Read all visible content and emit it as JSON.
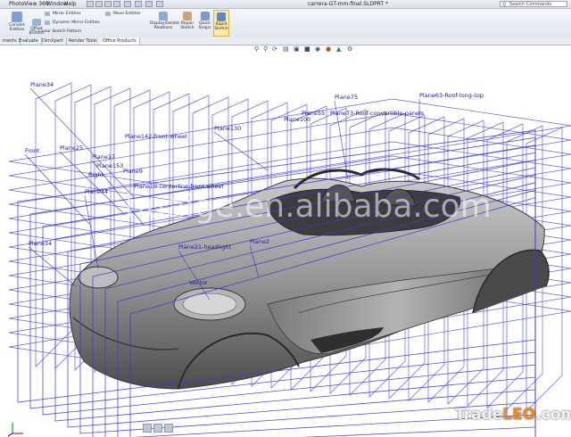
{
  "window": {
    "title": "carrera-GT-mm-final.SLDPRT *",
    "menus": [
      "PhotoView 360",
      "Window",
      "Help"
    ],
    "search_placeholder": "Search Commands"
  },
  "ribbon": {
    "buttons": [
      {
        "name": "convert-entities",
        "label1": "Convert",
        "label2": "Entities"
      },
      {
        "name": "offset-entities",
        "label1": "Offset",
        "label2": "Entities"
      },
      {
        "name": "display-delete-relations",
        "label1": "Display/Delete",
        "label2": "Relations"
      },
      {
        "name": "repair-sketch",
        "label1": "Repair",
        "label2": "Sketch"
      },
      {
        "name": "quick-snaps",
        "label1": "Quick",
        "label2": "Snaps"
      },
      {
        "name": "rapid-sketch",
        "label1": "Rapid",
        "label2": "Sketch"
      }
    ],
    "items": {
      "mirror": "Mirror Entities",
      "dynamic_mirror": "Dynamic Mirror Entities",
      "linear_pattern": "Linear Sketch Pattern",
      "move": "Move Entities"
    }
  },
  "tabs": [
    "ments",
    "Evaluate",
    "DimXpert",
    "Render Tools",
    "Office Products"
  ],
  "planes": {
    "p34a": "Plane34",
    "front": "Front",
    "p25": "Plane25",
    "p17": "Plane17",
    "p153": "Plane153",
    "right": "Right",
    "p9": "Plane9",
    "p44": "Plane44",
    "p34": "Plane34",
    "p75": "Plane75",
    "p55": "Plane55",
    "p100": "Plane100",
    "p130": "Plane130",
    "p2": "Plane2",
    "frontwheel": "Plane142-front-wheel",
    "roofconv": "Plane73-Roof-convertible-panels",
    "longtop": "Plane63-Roof-long-top",
    "center": "Plane19-centerline-front-wheel",
    "headlight": "Plane21-headlight",
    "vector": "Vector"
  },
  "watermark": "huaige.en.alibaba.com",
  "footer_watermark": {
    "part1": "Trade",
    "part2": "LEO",
    "part3": ".com"
  },
  "colors": {
    "plane_blue": "#3b3bd6",
    "car_gray": "#8a8a8a",
    "ribbon": "#e2e7ef",
    "active": "#ffe9a8"
  }
}
